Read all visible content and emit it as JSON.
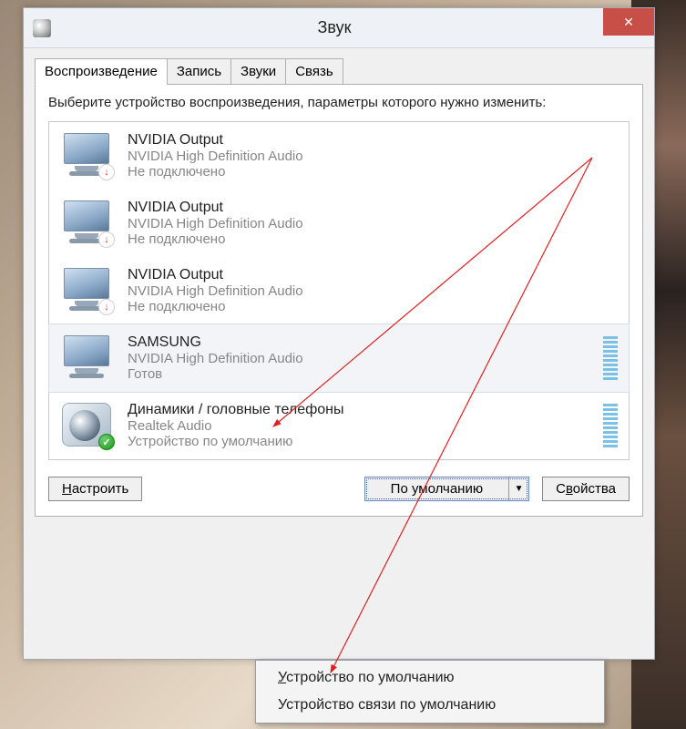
{
  "window": {
    "title": "Звук"
  },
  "tabs": [
    "Воспроизведение",
    "Запись",
    "Звуки",
    "Связь"
  ],
  "instruction": "Выберите устройство воспроизведения, параметры которого нужно изменить:",
  "devices": [
    {
      "name": "NVIDIA Output",
      "driver": "NVIDIA High Definition Audio",
      "status": "Не подключено",
      "icon": "monitor",
      "badge": "down",
      "meter": false,
      "selected": false
    },
    {
      "name": "NVIDIA Output",
      "driver": "NVIDIA High Definition Audio",
      "status": "Не подключено",
      "icon": "monitor",
      "badge": "down",
      "meter": false,
      "selected": false
    },
    {
      "name": "NVIDIA Output",
      "driver": "NVIDIA High Definition Audio",
      "status": "Не подключено",
      "icon": "monitor",
      "badge": "down",
      "meter": false,
      "selected": false
    },
    {
      "name": "SAMSUNG",
      "driver": "NVIDIA High Definition Audio",
      "status": "Готов",
      "icon": "monitor",
      "badge": null,
      "meter": true,
      "selected": true
    },
    {
      "name": "Динамики / головные телефоны",
      "driver": "Realtek Audio",
      "status": "Устройство по умолчанию",
      "icon": "speaker",
      "badge": "check",
      "meter": true,
      "selected": false
    }
  ],
  "buttons": {
    "configure": "Настроить",
    "set_default": "По умолчанию",
    "properties": "Свойства"
  },
  "dropdown": {
    "item1": "Устройство по умолчанию",
    "item2": "Устройство связи по умолчанию"
  }
}
